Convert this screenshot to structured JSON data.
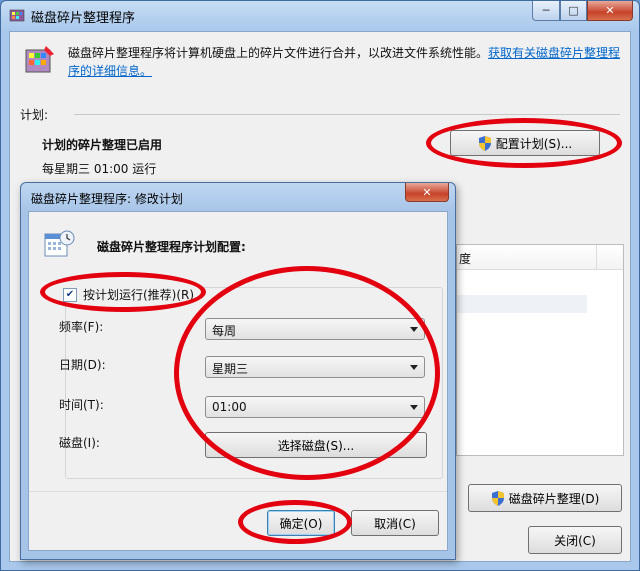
{
  "window": {
    "title": "磁盘碎片整理程序",
    "min": "─",
    "max": "□",
    "close": "✕"
  },
  "description": {
    "text": "磁盘碎片整理程序将计算机硬盘上的碎片文件进行合并，以改进文件系统性能。",
    "link": "获取有关磁盘碎片整理程序的详细信息。"
  },
  "schedule": {
    "section_label": "计划:",
    "status": "计划的碎片整理已启用",
    "detail": "每星期三 01:00 运行",
    "configure_button": "配置计划(S)..."
  },
  "background": {
    "column_header": "度",
    "defrag_button": "磁盘碎片整理(D)",
    "close_button": "关闭(C)"
  },
  "dialog": {
    "title": "磁盘碎片整理程序: 修改计划",
    "close": "✕",
    "heading": "磁盘碎片整理程序计划配置:",
    "run_on_schedule": {
      "label": "按计划运行(推荐)(R)",
      "checked": true
    },
    "frequency": {
      "label": "频率(F):",
      "value": "每周"
    },
    "day": {
      "label": "日期(D):",
      "value": "星期三"
    },
    "time": {
      "label": "时间(T):",
      "value": "01:00"
    },
    "disks": {
      "label": "磁盘(I):",
      "button": "选择磁盘(S)..."
    },
    "ok_button": "确定(O)",
    "cancel_button": "取消(C)"
  },
  "colors": {
    "highlight_oval": "#e3000f",
    "link": "#0066cc",
    "title_bar": "#a9c8ec"
  }
}
